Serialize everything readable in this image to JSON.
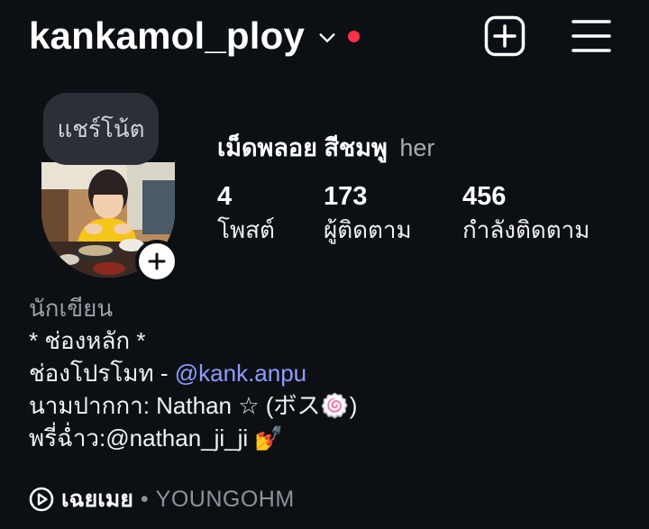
{
  "header": {
    "username": "kankamol_ploy",
    "notification_dot_color": "#ff2e4a",
    "icons": [
      "chevron-down-icon",
      "create-plus-icon",
      "hamburger-menu-icon"
    ]
  },
  "note": {
    "text": "แชร์โน้ต"
  },
  "profile": {
    "full_name": "เม็ดพลอย สีชมพู",
    "pronoun": "her"
  },
  "stats": [
    {
      "value": "4",
      "label": "โพสต์"
    },
    {
      "value": "173",
      "label": "ผู้ติดตาม"
    },
    {
      "value": "456",
      "label": "กำลังติดตาม"
    }
  ],
  "bio": {
    "category": "นักเขียน",
    "line1": "* ช่องหลัก *",
    "line2_prefix": "ช่องโปรโมท - ",
    "line2_mention": "@kank.anpu",
    "line3": "นามปากกา: Nathan ☆ (ボス🍥)",
    "line4_prefix": "พรี่ฉ่ำว:",
    "line4_mention": "@nathan_ji_ji",
    "line4_suffix": " 💅"
  },
  "music": {
    "title": "เฉยเมย",
    "separator": "•",
    "artist": "YOUNGOHM"
  },
  "colors": {
    "background": "#0c0f14",
    "mention": "#8f9cff",
    "note_bubble": "#2c3036"
  }
}
